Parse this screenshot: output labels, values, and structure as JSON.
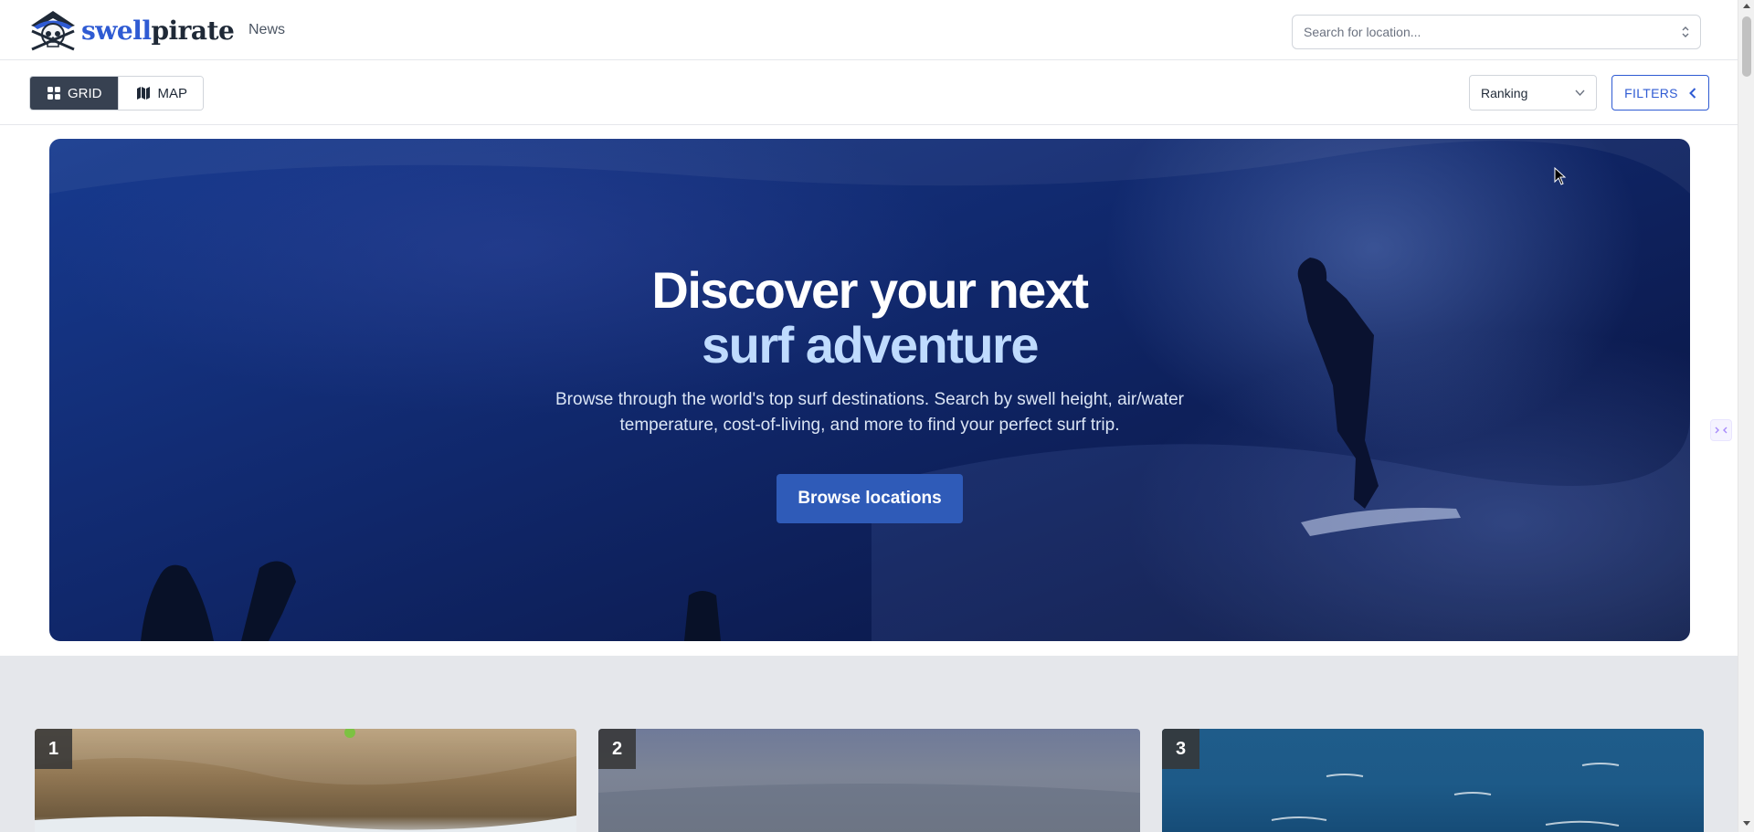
{
  "header": {
    "logo": {
      "part1": "swell",
      "part2": "pirate",
      "icon": "pirate-skull-icon"
    },
    "nav": [
      {
        "label": "News"
      }
    ],
    "search": {
      "placeholder": "Search for location...",
      "value": "",
      "icon": "updown-icon"
    }
  },
  "toolbar": {
    "view_toggle": [
      {
        "label": "GRID",
        "icon": "grid-icon",
        "active": true
      },
      {
        "label": "MAP",
        "icon": "map-icon",
        "active": false
      }
    ],
    "sort": {
      "selected": "Ranking",
      "icon": "chevron-down-icon"
    },
    "filters": {
      "label": "FILTERS",
      "icon": "chevron-left-icon"
    }
  },
  "hero": {
    "title_line1": "Discover your next",
    "title_line2": "surf adventure",
    "subtitle": "Browse through the world's top surf destinations. Search by swell height, air/water temperature, cost-of-living, and more to find your perfect surf trip.",
    "cta": "Browse locations"
  },
  "cards": [
    {
      "rank": "1"
    },
    {
      "rank": "2"
    },
    {
      "rank": "3"
    }
  ],
  "colors": {
    "brand": "#2f5bd3",
    "toggle_active": "#374151",
    "hero_cta": "#2f5bb8",
    "hero_title_accent": "#bfdbfe",
    "grid_background": "#e5e7eb"
  }
}
